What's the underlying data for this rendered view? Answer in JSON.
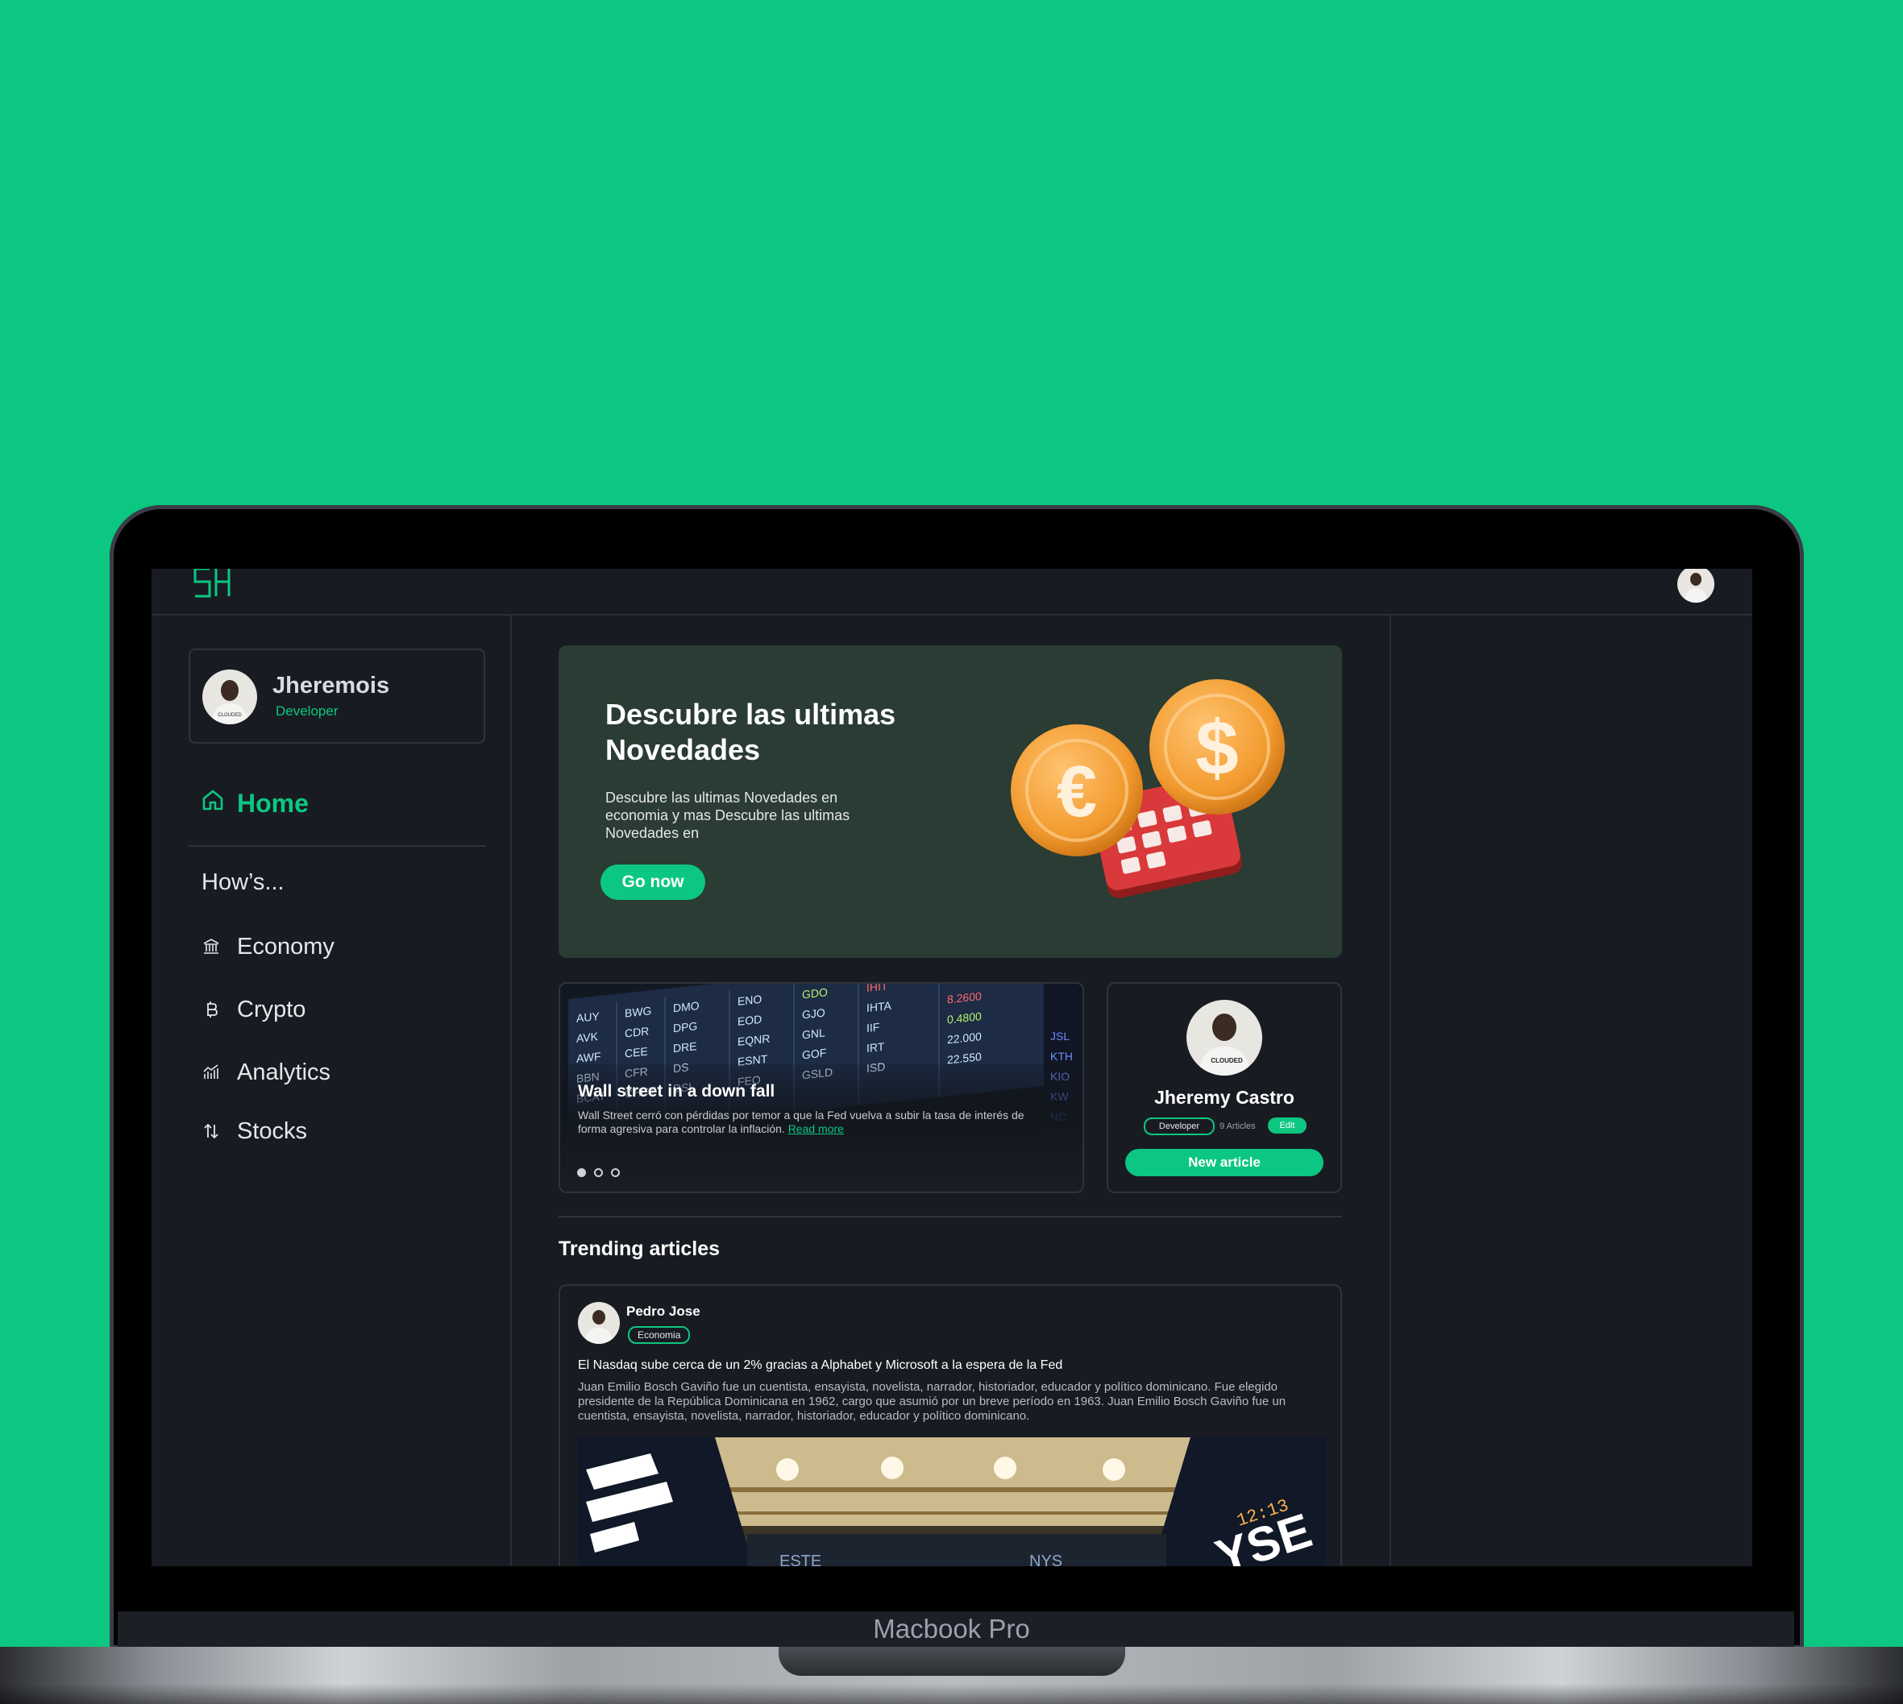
{
  "brand": {
    "logo_text": "SH"
  },
  "device_label": "Macbook Pro",
  "user": {
    "name": "Jheremois",
    "role": "Developer",
    "avatar_badge": "CLOUDED"
  },
  "nav": {
    "home_label": "Home",
    "section_title": "How’s...",
    "items": [
      {
        "label": "Economy",
        "icon": "bank-icon"
      },
      {
        "label": "Crypto",
        "icon": "bitcoin-icon"
      },
      {
        "label": "Analytics",
        "icon": "chart-icon"
      },
      {
        "label": "Stocks",
        "icon": "sort-arrows-icon"
      }
    ]
  },
  "hero": {
    "title": "Descubre las ultimas Novedades",
    "description": "Descubre las ultimas Novedades en economia y mas Descubre las ultimas Novedades en",
    "button_label": "Go now"
  },
  "slider": {
    "title": "Wall street in a down fall",
    "description": "Wall Street cerró con pérdidas por temor a que la Fed vuelva a subir la tasa de interés de forma agresiva para controlar la inflación.",
    "link_label": "Read more",
    "active_slide": 1,
    "slide_count": 3
  },
  "author": {
    "name": "Jheremy Castro",
    "role_chip": "Developer",
    "articles_count": "9 Articles",
    "edit_label": "Edit",
    "new_article_label": "New article",
    "avatar_badge": "CLOUDED"
  },
  "trending": {
    "title": "Trending articles",
    "articles": [
      {
        "author": "Pedro Jose",
        "tag": "Economia",
        "headline": "El Nasdaq sube cerca de un 2% gracias a Alphabet y Microsoft a la espera de la Fed",
        "body": "Juan Emilio Bosch Gaviño fue un cuentista, ensayista, novelista, narrador, historiador, educador y político dominicano. Fue elegido presidente de la República Dominicana en 1962, cargo que asumió por un breve período en 1963. Juan Emilio Bosch Gaviño fue un cuentista, ensayista, novelista, narrador, historiador, educador y político dominicano."
      }
    ]
  },
  "colors": {
    "accent": "#0cc781",
    "background": "#181b22",
    "hero_bg": "#2a3c33",
    "border": "#2f333d"
  }
}
